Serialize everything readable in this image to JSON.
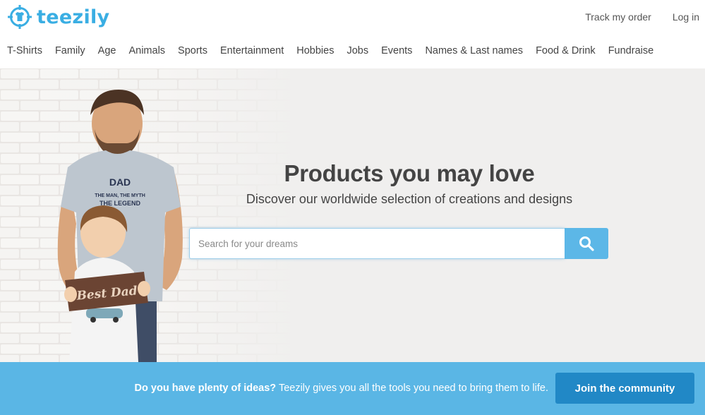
{
  "brand": {
    "name": "teezily",
    "color": "#3aaee3",
    "logo_icon": "crosshair-tshirt-icon"
  },
  "top_links": {
    "track_order": "Track my order",
    "login": "Log in"
  },
  "nav": {
    "items": [
      {
        "label": "T-Shirts"
      },
      {
        "label": "Family"
      },
      {
        "label": "Age"
      },
      {
        "label": "Animals"
      },
      {
        "label": "Sports"
      },
      {
        "label": "Entertainment"
      },
      {
        "label": "Hobbies"
      },
      {
        "label": "Jobs"
      },
      {
        "label": "Events"
      },
      {
        "label": "Names & Last names"
      },
      {
        "label": "Food & Drink"
      },
      {
        "label": "Fundraise"
      }
    ]
  },
  "hero": {
    "title": "Products you may love",
    "subtitle": "Discover our worldwide selection of creations and designs",
    "search": {
      "placeholder": "Search for your dreams",
      "value": "",
      "icon": "search-icon"
    },
    "photo": {
      "shirt_lines": [
        "DAD",
        "THE MAN, THE MYTH",
        "THE LEGEND"
      ],
      "sign_text": "Best Dad"
    }
  },
  "banner": {
    "bold_text": "Do you have plenty of ideas?",
    "text": " Teezily gives you all the tools you need to bring them to life.",
    "button_label": "Join the community",
    "colors": {
      "background": "#5ab6e5",
      "button": "#2188c6"
    }
  }
}
